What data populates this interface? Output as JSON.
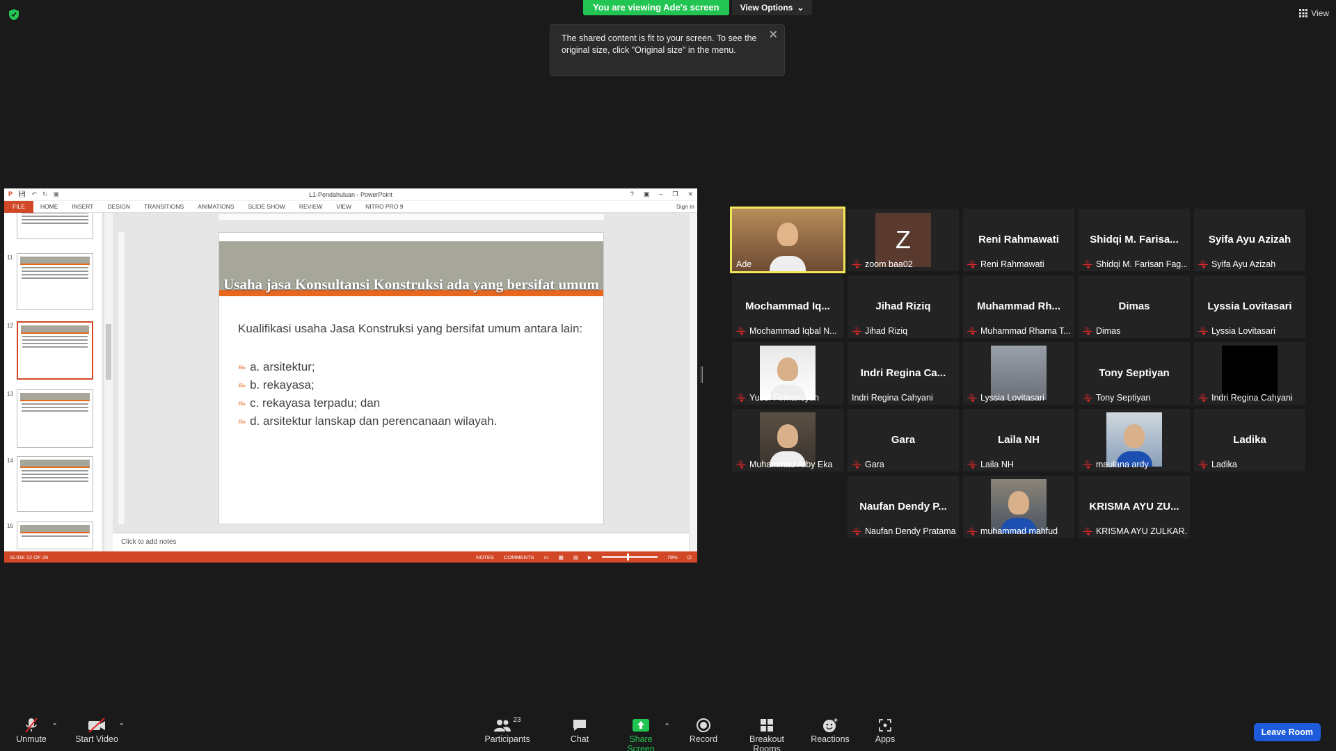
{
  "topbar": {
    "viewing_label": "You are viewing Ade's screen",
    "view_options_label": "View Options",
    "view_label": "View"
  },
  "tooltip": {
    "text": "The shared content is fit to your screen. To see the original size, click \"Original size\" in the menu."
  },
  "ppt": {
    "window_title": "L1-Pendahuluan - PowerPoint",
    "ribbon_tabs": [
      "FILE",
      "HOME",
      "INSERT",
      "DESIGN",
      "TRANSITIONS",
      "ANIMATIONS",
      "SLIDE SHOW",
      "REVIEW",
      "VIEW",
      "NITRO PRO 9"
    ],
    "sign_in": "Sign in",
    "thumb_numbers": [
      "11",
      "12",
      "13",
      "14",
      "15"
    ],
    "slide": {
      "title": "Usaha jasa Konsultansi Konstruksi ada yang bersifat umum",
      "lead": "Kualifikasi usaha Jasa Konstruksi yang bersifat umum antara lain:",
      "bullets": [
        "a. arsitektur;",
        "b. rekayasa;",
        "c. rekayasa terpadu; dan",
        "d. arsitektur lanskap dan perencanaan wilayah."
      ]
    },
    "notes_placeholder": "Click to add notes",
    "status": {
      "slide_counter": "SLIDE 12 OF 29",
      "notes": "NOTES",
      "comments": "COMMENTS",
      "zoom": "79%"
    }
  },
  "participants": [
    {
      "big": "",
      "caption": "Ade",
      "photo": true,
      "active": true,
      "muted": false
    },
    {
      "big": "",
      "caption": "zoom baa02",
      "avatar_letter": "Z",
      "muted": true
    },
    {
      "big": "Reni Rahmawati",
      "caption": "Reni Rahmawati",
      "muted": true
    },
    {
      "big": "Shidqi M. Farisa...",
      "caption": "Shidqi M. Farisan Fag...",
      "muted": true
    },
    {
      "big": "Syifa Ayu Azizah",
      "caption": "Syifa Ayu Azizah",
      "muted": true
    },
    {
      "big": "Mochammad Iq...",
      "caption": "Mochammad Iqbal N...",
      "muted": true
    },
    {
      "big": "Jihad Riziq",
      "caption": "Jihad Riziq",
      "muted": true
    },
    {
      "big": "Muhammad Rh...",
      "caption": "Muhammad Rhama T...",
      "muted": true
    },
    {
      "big": "Dimas",
      "caption": "Dimas",
      "muted": true
    },
    {
      "big": "Lyssia Lovitasari",
      "caption": "Lyssia Lovitasari",
      "muted": true
    },
    {
      "big": "",
      "caption": "Yusuf Firmansyah",
      "photo": true,
      "muted": true
    },
    {
      "big": "Indri Regina Ca...",
      "caption": "Indri Regina Cahyani",
      "muted": false
    },
    {
      "big": "",
      "caption": "Lyssia Lovitasari",
      "photo": true,
      "muted": true
    },
    {
      "big": "Tony Septiyan",
      "caption": "Tony Septiyan",
      "muted": true
    },
    {
      "big": "",
      "caption": "Indri Regina Cahyani",
      "photo": true,
      "black": true,
      "muted": true
    },
    {
      "big": "",
      "caption": "Muhammad Arby Eka",
      "photo": true,
      "muted": true
    },
    {
      "big": "Gara",
      "caption": "Gara",
      "muted": true
    },
    {
      "big": "Laila NH",
      "caption": "Laila NH",
      "muted": true
    },
    {
      "big": "",
      "caption": "maulana ardy",
      "photo": true,
      "muted": true
    },
    {
      "big": "Ladika",
      "caption": "Ladika",
      "muted": true
    },
    {
      "big": "Naufan Dendy P...",
      "caption": "Naufan Dendy Pratama",
      "muted": true
    },
    {
      "big": "",
      "caption": "muhammad mahfud",
      "photo": true,
      "muted": true
    },
    {
      "big": "KRISMA AYU ZU...",
      "caption": "KRISMA AYU ZULKAR...",
      "muted": true
    }
  ],
  "toolbar": {
    "unmute": "Unmute",
    "start_video": "Start Video",
    "participants": "Participants",
    "participants_count": "23",
    "chat": "Chat",
    "share_screen": "Share Screen",
    "record": "Record",
    "breakout_rooms": "Breakout Rooms",
    "reactions": "Reactions",
    "apps": "Apps",
    "leave_room": "Leave Room"
  },
  "colors": {
    "zoom_green": "#23c552",
    "ppt_orange": "#d24726",
    "slide_accent": "#e6671d",
    "leave_blue": "#1d5adc",
    "active_speaker": "#f1e75a"
  }
}
